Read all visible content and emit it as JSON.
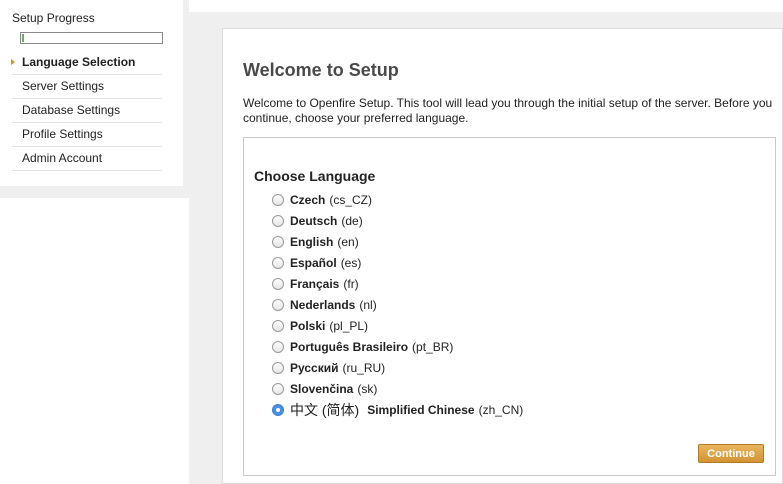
{
  "sidebar": {
    "progress_title": "Setup Progress",
    "progress_fraction": 0.01,
    "progress_color": "#5fb554",
    "steps": [
      {
        "label": "Language Selection",
        "active": true
      },
      {
        "label": "Server Settings",
        "active": false
      },
      {
        "label": "Database Settings",
        "active": false
      },
      {
        "label": "Profile Settings",
        "active": false
      },
      {
        "label": "Admin Account",
        "active": false
      }
    ]
  },
  "main": {
    "title": "Welcome to Setup",
    "intro": "Welcome to Openfire Setup. This tool will lead you through the initial setup of the server. Before you continue, choose your preferred language.",
    "language_heading": "Choose Language",
    "languages": [
      {
        "name": "Czech",
        "code": "(cs_CZ)",
        "selected": false
      },
      {
        "name": "Deutsch",
        "code": "(de)",
        "selected": false
      },
      {
        "name": "English",
        "code": "(en)",
        "selected": false
      },
      {
        "name": "Español",
        "code": "(es)",
        "selected": false
      },
      {
        "name": "Français",
        "code": "(fr)",
        "selected": false
      },
      {
        "name": "Nederlands",
        "code": "(nl)",
        "selected": false
      },
      {
        "name": "Polski",
        "code": "(pl_PL)",
        "selected": false
      },
      {
        "name": "Português Brasileiro",
        "code": "(pt_BR)",
        "selected": false
      },
      {
        "name": "Русский",
        "code": "(ru_RU)",
        "selected": false
      },
      {
        "name": "Slovenčina",
        "code": "(sk)",
        "selected": false
      },
      {
        "native": "中文 (简体)",
        "name": "Simplified Chinese",
        "code": "(zh_CN)",
        "selected": true
      }
    ],
    "continue_label": "Continue",
    "accent_color": "#d8901c"
  }
}
